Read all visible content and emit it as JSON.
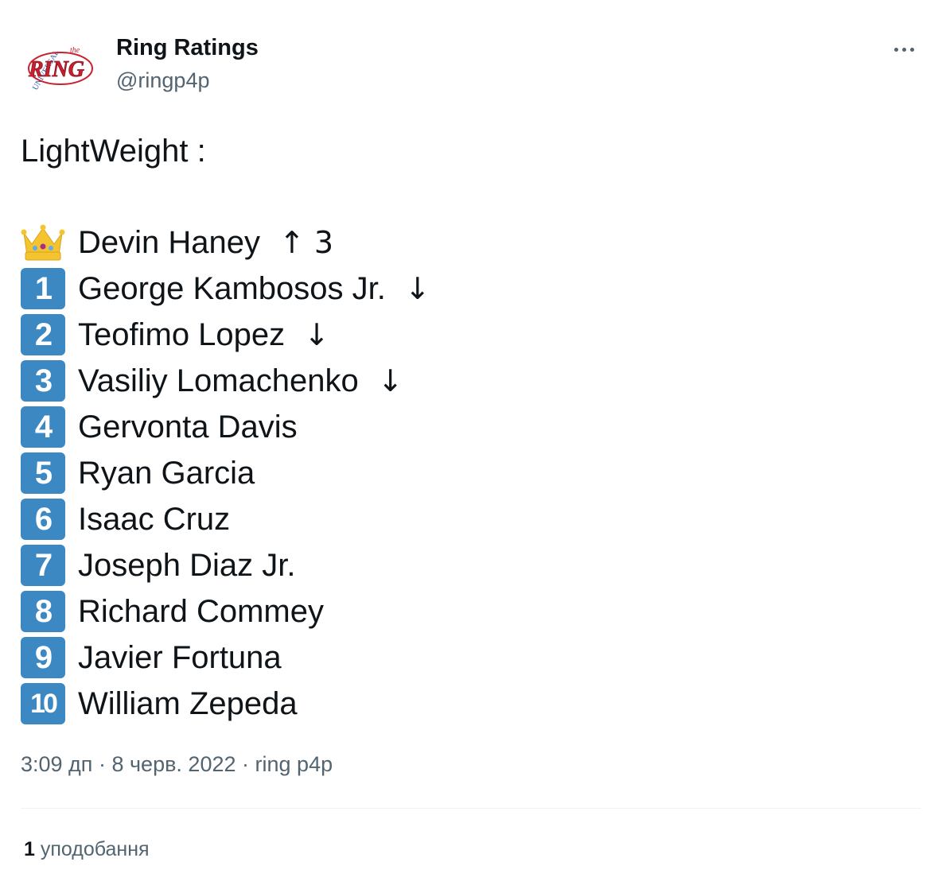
{
  "author": {
    "display_name": "Ring Ratings",
    "handle": "@ringp4p",
    "avatar_icon": "ring-magazine-logo",
    "avatar_logo_text": "RING",
    "avatar_logo_small_text": "the",
    "avatar_arc_text": "UNIVERSAL"
  },
  "menu": {
    "icon": "more-horizontal-icon"
  },
  "tweet": {
    "title": "LightWeight :",
    "rankings": [
      {
        "badge": "👑",
        "badge_type": "crown-icon",
        "name": "Devin Haney",
        "move": "↑ 3"
      },
      {
        "badge": "1",
        "name": "George Kambosos Jr.",
        "move": "↓"
      },
      {
        "badge": "2",
        "name": "Teofimo Lopez",
        "move": "↓"
      },
      {
        "badge": "3",
        "name": "Vasiliy Lomachenko",
        "move": "↓"
      },
      {
        "badge": "4",
        "name": "Gervonta Davis",
        "move": ""
      },
      {
        "badge": "5",
        "name": "Ryan Garcia",
        "move": ""
      },
      {
        "badge": "6",
        "name": "Isaac Cruz",
        "move": ""
      },
      {
        "badge": "7",
        "name": "Joseph Diaz Jr.",
        "move": ""
      },
      {
        "badge": "8",
        "name": "Richard Commey",
        "move": ""
      },
      {
        "badge": "9",
        "name": "Javier Fortuna",
        "move": ""
      },
      {
        "badge": "10",
        "name": "William Zepeda",
        "move": ""
      }
    ]
  },
  "meta": {
    "time": "3:09 дп",
    "separator": "·",
    "date": "8 черв. 2022",
    "source": "ring p4p"
  },
  "stats": {
    "likes_count": "1",
    "likes_label": "уподобання"
  },
  "colors": {
    "keycap_blue": "#3b88c3",
    "secondary_text": "#536471",
    "primary_text": "#0f1419",
    "logo_red": "#c8202f",
    "logo_blue": "#2e4fa3"
  }
}
